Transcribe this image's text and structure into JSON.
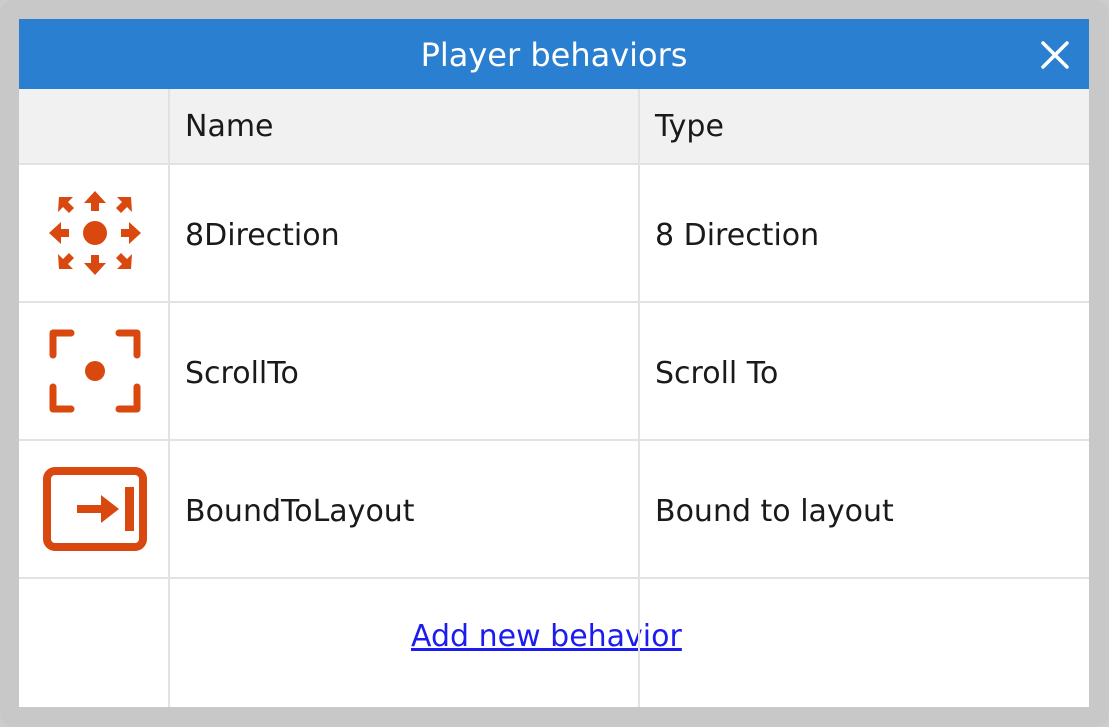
{
  "dialog": {
    "title": "Player behaviors",
    "close_icon": "close-icon"
  },
  "table": {
    "columns": [
      "Name",
      "Type"
    ],
    "rows": [
      {
        "name": "8Direction",
        "type": "8 Direction",
        "icon": "eight-direction-icon"
      },
      {
        "name": "ScrollTo",
        "type": "Scroll To",
        "icon": "scroll-to-icon"
      },
      {
        "name": "BoundToLayout",
        "type": "Bound to layout",
        "icon": "bound-to-layout-icon"
      }
    ]
  },
  "actions": {
    "add_behavior": "Add new behavior"
  },
  "colors": {
    "titlebar": "#2b7fd0",
    "icon": "#d9480f",
    "link": "#1c1cf0"
  }
}
